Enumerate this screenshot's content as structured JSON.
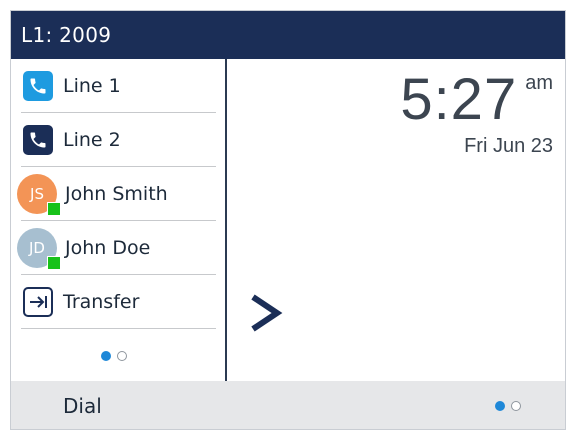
{
  "header": {
    "title": "L1: 2009"
  },
  "keys": [
    {
      "type": "line",
      "label": "Line 1",
      "icon": "phone-icon",
      "icon_bg": "#1e9be0"
    },
    {
      "type": "line",
      "label": "Line 2",
      "icon": "phone-icon",
      "icon_bg": "#1b2e57"
    },
    {
      "type": "contact",
      "label": "John Smith",
      "initials": "JS",
      "avatar_color": "#f39456",
      "presence": "available",
      "presence_color": "#18c21a"
    },
    {
      "type": "contact",
      "label": "John Doe",
      "initials": "JD",
      "avatar_color": "#a7bfd0",
      "presence": "available",
      "presence_color": "#18c21a"
    },
    {
      "type": "action",
      "label": "Transfer",
      "icon": "transfer-arrow-icon"
    }
  ],
  "left_pager": {
    "current": 1,
    "total": 2
  },
  "clock": {
    "time": "5:27",
    "ampm": "am",
    "date": "Fri Jun 23"
  },
  "next_page_indicator": {
    "icon": "chevron-right-icon"
  },
  "softkeys": {
    "dial_label": "Dial"
  },
  "bottom_pager": {
    "current": 1,
    "total": 2
  },
  "colors": {
    "header_bg": "#1b2e57",
    "accent": "#1e88d8",
    "softkey_bg": "#e6e7e9"
  }
}
